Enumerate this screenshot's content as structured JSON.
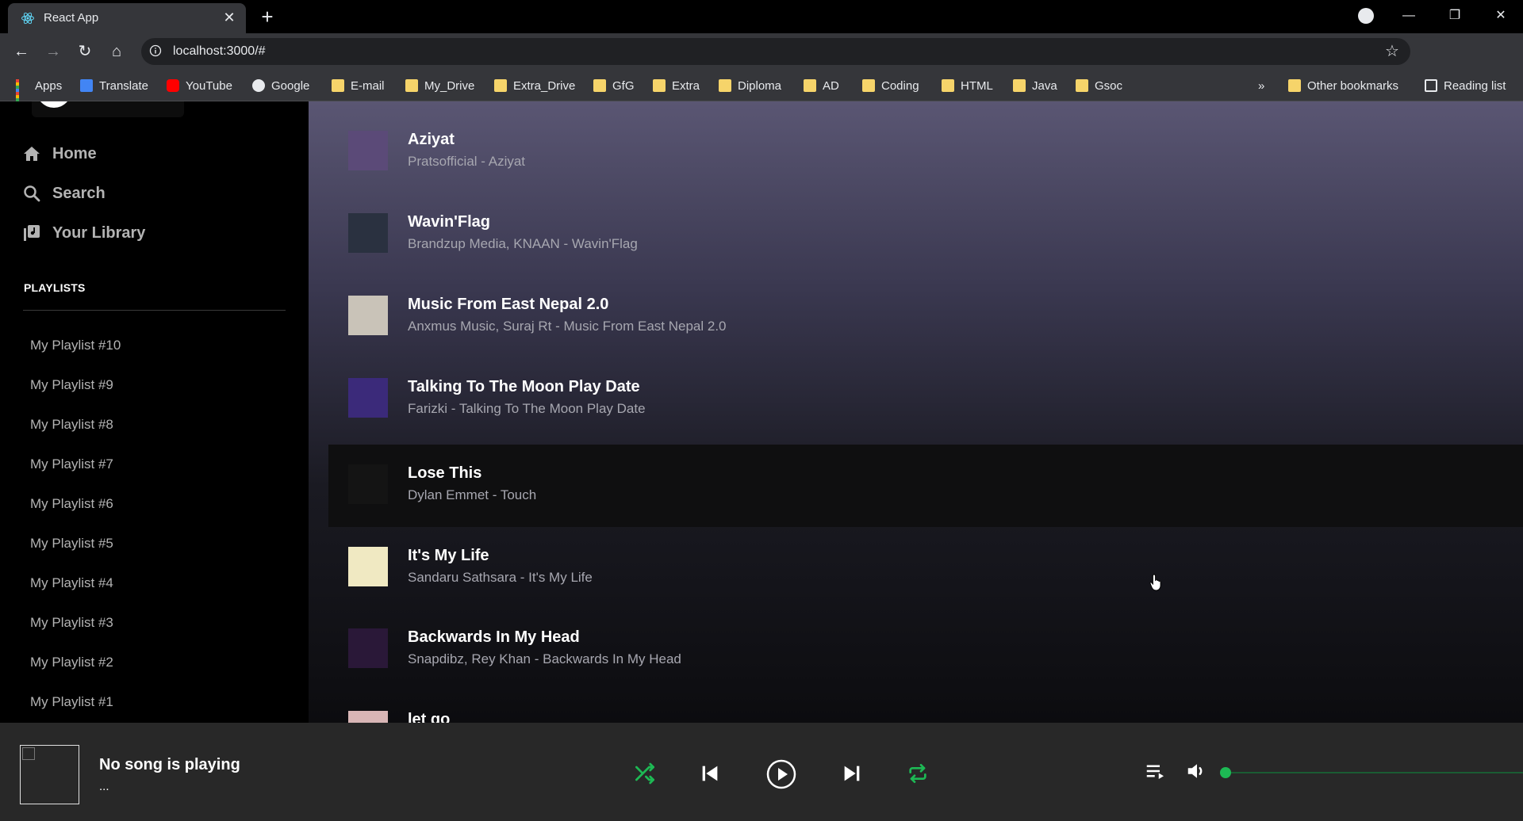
{
  "browser": {
    "tab_title": "React App",
    "url": "localhost:3000/#",
    "bookmarks": [
      {
        "label": "Apps",
        "icon": "apps-grid-icon"
      },
      {
        "label": "Translate",
        "icon": "translate-icon"
      },
      {
        "label": "YouTube",
        "icon": "youtube-icon"
      },
      {
        "label": "Google",
        "icon": "globe-icon"
      },
      {
        "label": "E-mail",
        "icon": "folder-icon"
      },
      {
        "label": "My_Drive",
        "icon": "folder-icon"
      },
      {
        "label": "Extra_Drive",
        "icon": "folder-icon"
      },
      {
        "label": "GfG",
        "icon": "folder-icon"
      },
      {
        "label": "Extra",
        "icon": "folder-icon"
      },
      {
        "label": "Diploma",
        "icon": "folder-icon"
      },
      {
        "label": "AD",
        "icon": "folder-icon"
      },
      {
        "label": "Coding",
        "icon": "folder-icon"
      },
      {
        "label": "HTML",
        "icon": "folder-icon"
      },
      {
        "label": "Java",
        "icon": "folder-icon"
      },
      {
        "label": "Gsoc",
        "icon": "folder-icon"
      }
    ],
    "overflow": "»",
    "other_bookmarks": "Other bookmarks",
    "reading_list": "Reading list"
  },
  "sidebar": {
    "nav": [
      {
        "label": "Home",
        "icon": "home-icon"
      },
      {
        "label": "Search",
        "icon": "search-icon"
      },
      {
        "label": "Your Library",
        "icon": "library-icon"
      }
    ],
    "playlists_title": "PLAYLISTS",
    "playlists": [
      "My Playlist #10",
      "My Playlist #9",
      "My Playlist #8",
      "My Playlist #7",
      "My Playlist #6",
      "My Playlist #5",
      "My Playlist #4",
      "My Playlist #3",
      "My Playlist #2",
      "My Playlist #1"
    ]
  },
  "songs": [
    {
      "title": "Aziyat",
      "subtitle": "Pratsofficial - Aziyat",
      "art_color": "#5b4a78"
    },
    {
      "title": "Wavin'Flag",
      "subtitle": "Brandzup Media, KNAAN - Wavin'Flag",
      "art_color": "#2a3140"
    },
    {
      "title": "Music From East Nepal 2.0",
      "subtitle": "Anxmus Music, Suraj Rt - Music From East Nepal 2.0",
      "art_color": "#c9c3b8"
    },
    {
      "title": "Talking To The Moon Play Date",
      "subtitle": "Farizki - Talking To The Moon Play Date",
      "art_color": "#3b2a7a"
    },
    {
      "title": "Lose This",
      "subtitle": "Dylan Emmet - Touch",
      "art_color": "#141414"
    },
    {
      "title": "It's My Life",
      "subtitle": "Sandaru Sathsara - It's My Life",
      "art_color": "#f0e9c2"
    },
    {
      "title": "Backwards In My Head",
      "subtitle": "Snapdibz, Rey Khan - Backwards In My Head",
      "art_color": "#2a1838"
    },
    {
      "title": "let go",
      "subtitle": "",
      "art_color": "#d9b6b6"
    }
  ],
  "player": {
    "title": "No song is playing",
    "subtitle": "...",
    "accent": "#1db954",
    "volume": 0
  }
}
